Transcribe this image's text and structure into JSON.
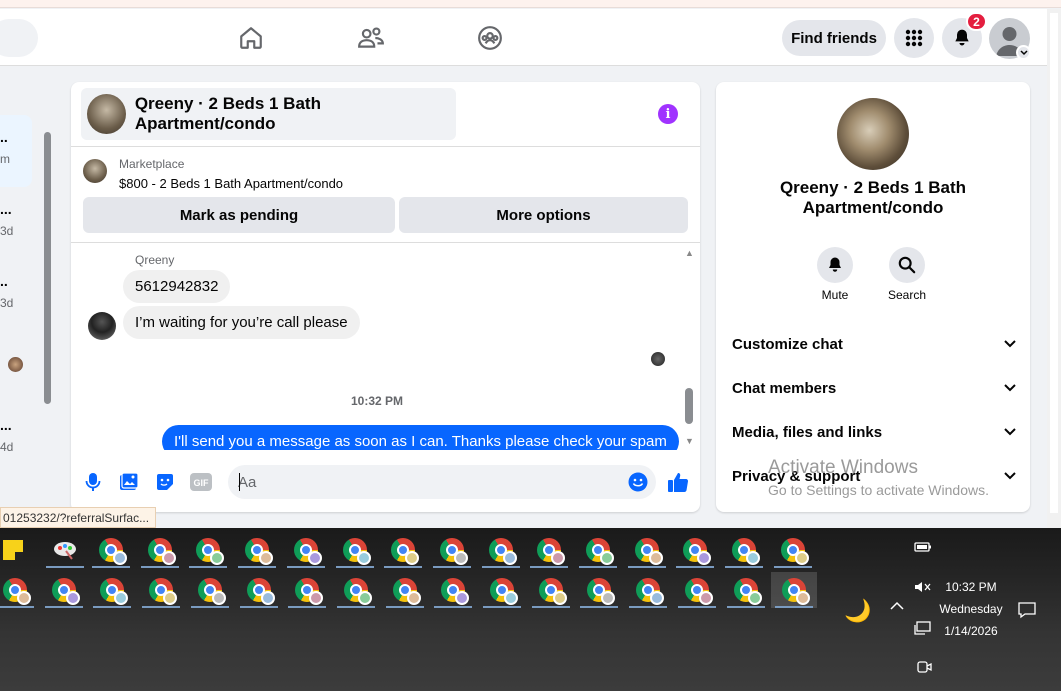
{
  "nav": {
    "find_friends": "Find friends",
    "notification_count": "2"
  },
  "sidebar": {
    "items": [
      {
        "dots": "..",
        "sub": "m"
      },
      {
        "dots": "...",
        "sub": "3d"
      },
      {
        "dots": "..",
        "sub": "3d"
      },
      {
        "dots": "...",
        "sub": "4d"
      }
    ]
  },
  "chat": {
    "title": "Qreeny · 2 Beds 1 Bath Apartment/condo",
    "info_icon": "i",
    "marketplace_label": "Marketplace",
    "listing": "$800 - 2 Beds 1 Bath Apartment/condo",
    "mark_pending": "Mark as pending",
    "more_options": "More options",
    "sender_name": "Qreeny",
    "messages_in": [
      "5612942832",
      "I’m waiting for you’re call please"
    ],
    "timestamp": "10:32 PM",
    "message_out": "I'll send you a message as soon as I can. Thanks please check your spam",
    "composer_placeholder": "Aa"
  },
  "info_panel": {
    "name": "Qreeny · 2 Beds 1 Bath Apartment/condo",
    "mute_label": "Mute",
    "search_label": "Search",
    "sections": [
      "Customize chat",
      "Chat members",
      "Media, files and links",
      "Privacy & support"
    ]
  },
  "watermark": {
    "line1": "Activate Windows",
    "line2": "Go to Settings to activate Windows."
  },
  "status_url": "01253232/?referralSurfac...",
  "taskbar": {
    "time": "10:32 PM",
    "day": "Wednesday",
    "date": "1/14/2026"
  },
  "colors": {
    "accent": "#0866ff",
    "info_purple": "#a033ff",
    "badge_red": "#e41e3f"
  }
}
